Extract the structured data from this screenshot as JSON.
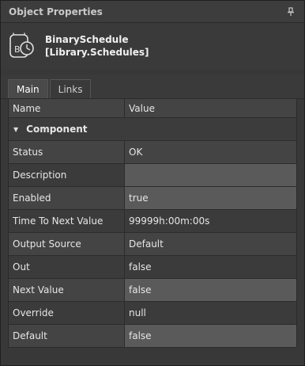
{
  "panel": {
    "title": "Object Properties"
  },
  "object": {
    "name": "BinarySchedule",
    "library": "[Library.Schedules]"
  },
  "tabs": [
    {
      "label": "Main"
    },
    {
      "label": "Links"
    }
  ],
  "grid": {
    "columns": {
      "name": "Name",
      "value": "Value"
    },
    "group": "Component",
    "rows": [
      {
        "name": "Status",
        "value": "OK"
      },
      {
        "name": "Description",
        "value": ""
      },
      {
        "name": "Enabled",
        "value": "true"
      },
      {
        "name": "Time To Next Value",
        "value": "99999h:00m:00s"
      },
      {
        "name": "Output Source",
        "value": "Default"
      },
      {
        "name": "Out",
        "value": "false"
      },
      {
        "name": "Next Value",
        "value": "false"
      },
      {
        "name": "Override",
        "value": "null"
      },
      {
        "name": "Default",
        "value": "false"
      }
    ]
  }
}
